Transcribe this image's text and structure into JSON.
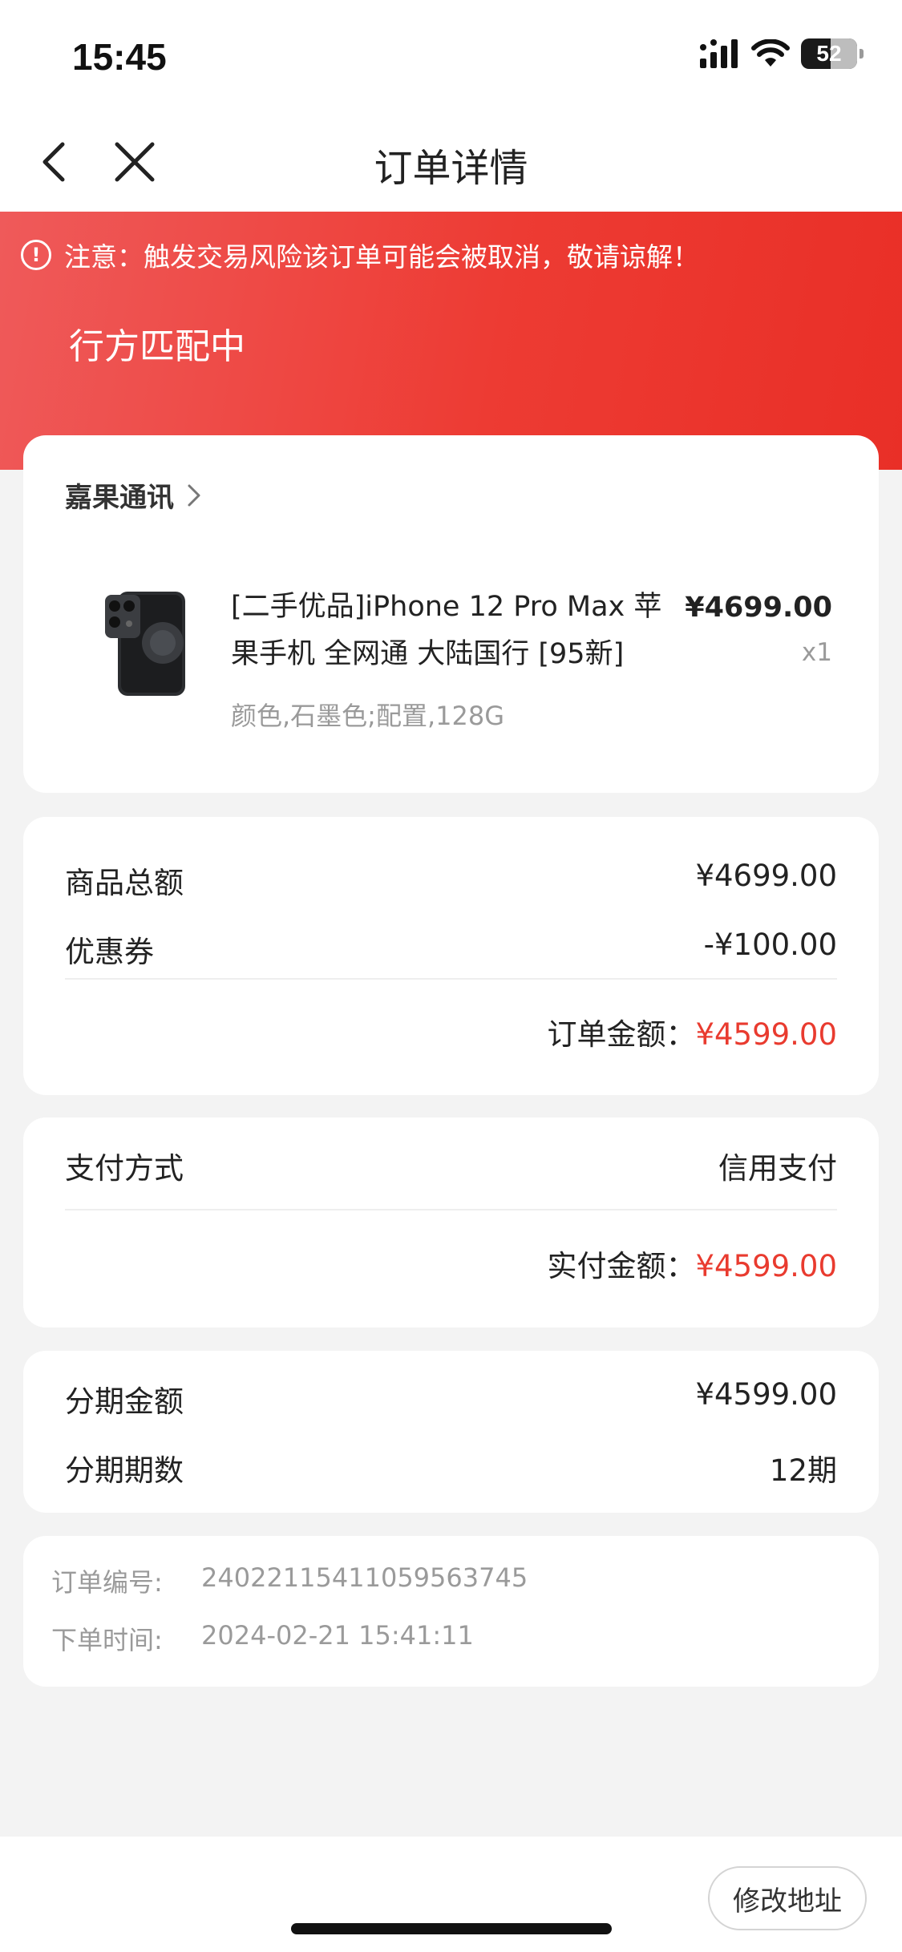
{
  "status_bar": {
    "time": "15:45",
    "battery": "52"
  },
  "nav": {
    "title": "订单详情"
  },
  "header": {
    "warning": "注意：触发交易风险该订单可能会被取消，敬请谅解！",
    "order_status": "行方匹配中"
  },
  "shop": {
    "name": "嘉果通讯",
    "product": {
      "title": "[二手优品]iPhone 12 Pro Max 苹果手机 全网通 大陆国行 [95新]",
      "spec": "颜色,石墨色;配置,128G",
      "price": "¥4699.00",
      "qty": "x1"
    }
  },
  "amounts": {
    "goods_total_label": "商品总额",
    "goods_total_value": "¥4699.00",
    "coupon_label": "优惠券",
    "coupon_value": "-¥100.00",
    "order_amount_label": "订单金额：",
    "order_amount_value": "¥4599.00"
  },
  "payment": {
    "method_label": "支付方式",
    "method_value": "信用支付",
    "paid_label": "实付金额：",
    "paid_value": "¥4599.00"
  },
  "installment": {
    "amount_label": "分期金额",
    "amount_value": "¥4599.00",
    "periods_label": "分期期数",
    "periods_value": "12期"
  },
  "order_info": {
    "number_label": "订单编号:",
    "number_value": "24022115411059563745",
    "time_label": "下单时间:",
    "time_value": "2024-02-21 15:41:11"
  },
  "bottom": {
    "modify_address": "修改地址"
  },
  "colors": {
    "accent_red": "#e93b2f",
    "header_red": "#ed3b33"
  }
}
